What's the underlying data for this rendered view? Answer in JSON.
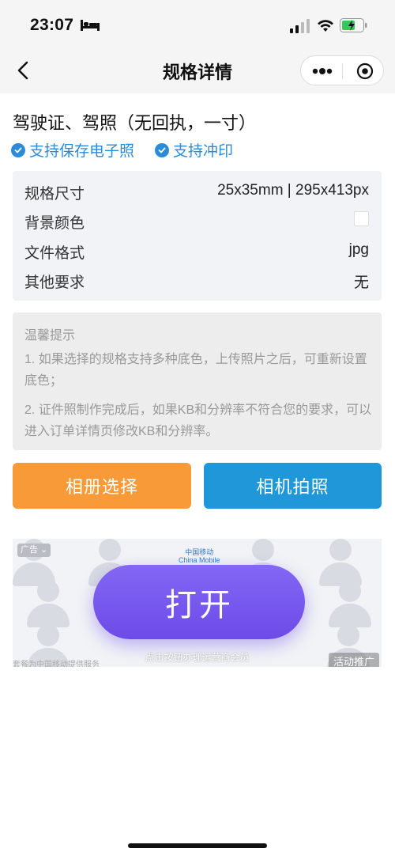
{
  "status_bar": {
    "time": "23:07"
  },
  "nav": {
    "title": "规格详情"
  },
  "heading": "驾驶证、驾照（无回执，一寸）",
  "features": [
    "支持保存电子照",
    "支持冲印"
  ],
  "specs": [
    {
      "label": "规格尺寸",
      "value": "25x35mm | 295x413px"
    },
    {
      "label": "背景颜色",
      "value": "",
      "swatch_color": "#ffffff"
    },
    {
      "label": "文件格式",
      "value": "jpg"
    },
    {
      "label": "其他要求",
      "value": "无"
    }
  ],
  "tips": {
    "title": "温馨提示",
    "items": [
      "1. 如果选择的规格支持多种底色，上传照片之后，可重新设置底色；",
      "2. 证件照制作完成后，如果KB和分辨率不符合您的要求，可以进入订单详情页修改KB和分辨率。"
    ]
  },
  "buttons": {
    "album": "相册选择",
    "camera": "相机拍照"
  },
  "ad": {
    "badge": "广告",
    "carrier": "中国移动",
    "carrier_en": "China Mobile",
    "open_label": "打开",
    "subtitle": "点击按钮办理运营商会员",
    "provider": "套餐为中国移动提供服务",
    "promo": "活动推广"
  },
  "colors": {
    "accent_blue": "#2b8bd8",
    "album_button": "#f79a37",
    "camera_button": "#1f97d8",
    "ad_button": "#7458ee"
  }
}
